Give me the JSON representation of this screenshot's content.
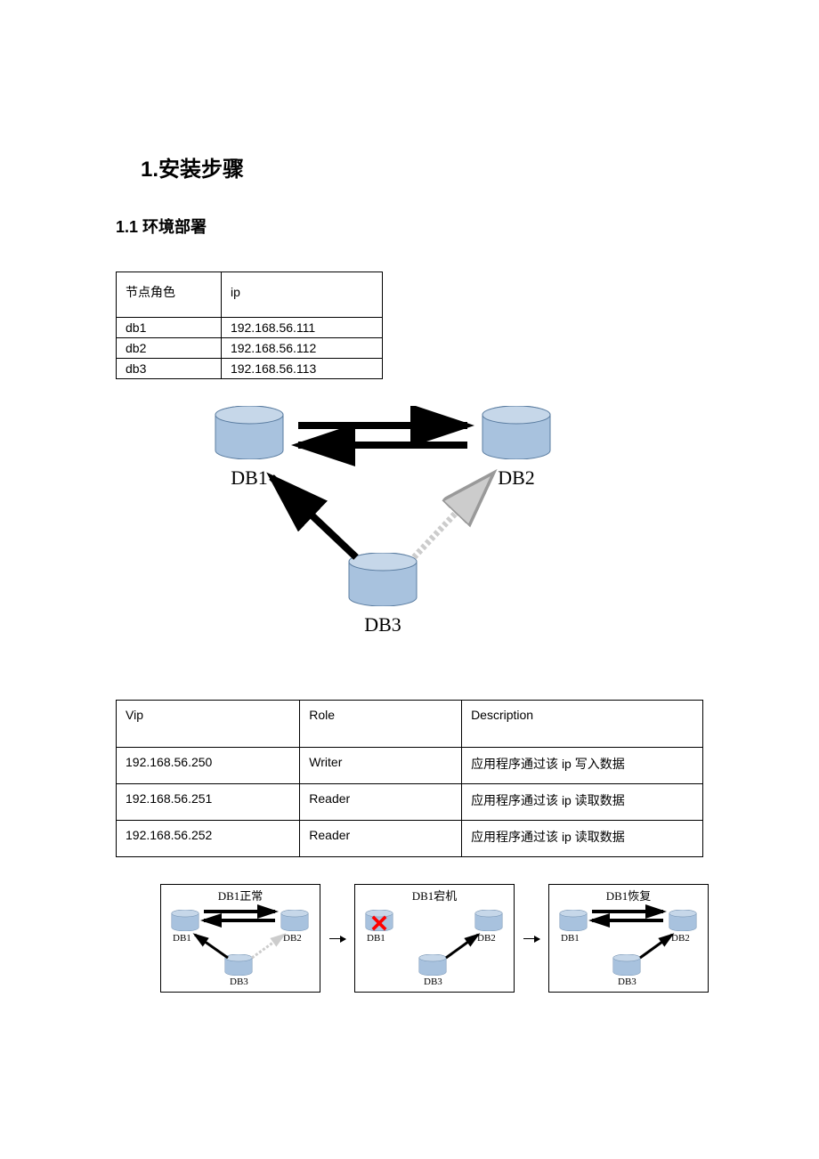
{
  "headings": {
    "h1": "1.安装步骤",
    "h2": "1.1 环境部署"
  },
  "node_table": {
    "headers": {
      "role": "节点角色",
      "ip": "ip"
    },
    "rows": [
      {
        "role": "db1",
        "ip": "192.168.56.111"
      },
      {
        "role": "db2",
        "ip": "192.168.56.112"
      },
      {
        "role": "db3",
        "ip": "192.168.56.113"
      }
    ]
  },
  "diagram": {
    "db1": "DB1",
    "db2": "DB2",
    "db3": "DB3"
  },
  "vip_table": {
    "headers": {
      "vip": "Vip",
      "role": "Role",
      "desc": "Description"
    },
    "rows": [
      {
        "vip": "192.168.56.250",
        "role": "Writer",
        "desc": "应用程序通过该 ip 写入数据"
      },
      {
        "vip": "192.168.56.251",
        "role": "Reader",
        "desc": "应用程序通过该 ip 读取数据"
      },
      {
        "vip": "192.168.56.252",
        "role": "Reader",
        "desc": "应用程序通过该 ip 读取数据"
      }
    ]
  },
  "states": {
    "0": {
      "title": "DB1正常",
      "db1": "DB1",
      "db2": "DB2",
      "db3": "DB3"
    },
    "1": {
      "title": "DB1宕机",
      "db1": "DB1",
      "db2": "DB2",
      "db3": "DB3"
    },
    "2": {
      "title": "DB1恢复",
      "db1": "DB1",
      "db2": "DB2",
      "db3": "DB3"
    }
  }
}
